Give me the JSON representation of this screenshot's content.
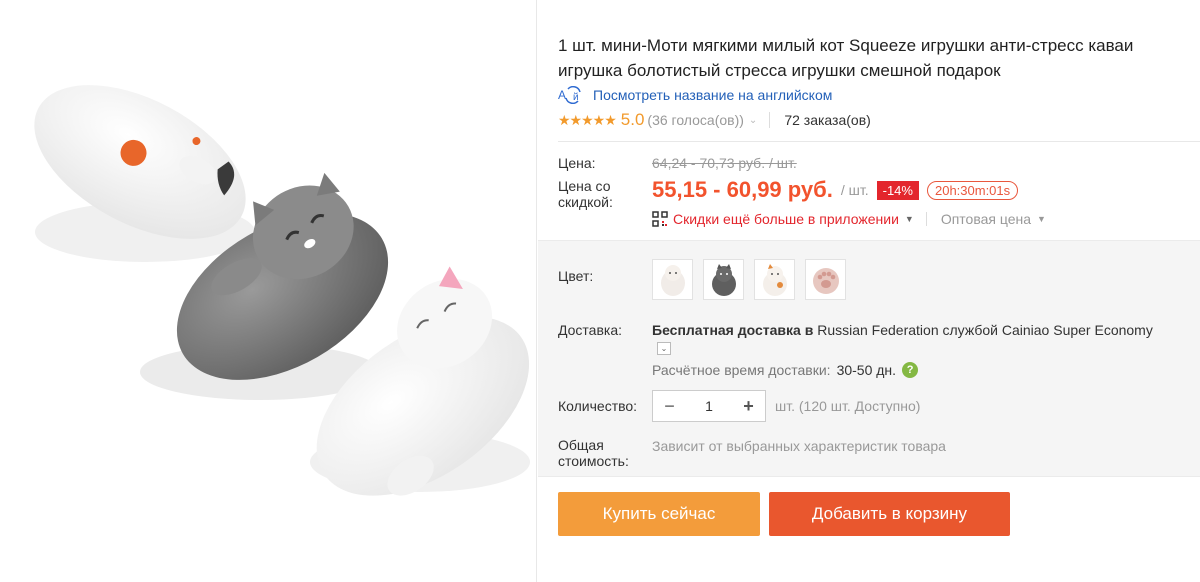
{
  "product": {
    "title": "1 шт. мини-Моти мягкими милый кот Squeeze игрушки анти-стресс каваи игрушка болотистый стресса игрушки смешной подарок",
    "translate_link": "Посмотреть название на английском",
    "translate_icon": "translate-icon",
    "rating": {
      "stars": "★★★★★",
      "value": "5.0",
      "votes": "(36 голоса(ов))",
      "orders": "72 заказа(ов)"
    }
  },
  "price": {
    "price_label": "Цена:",
    "old_price": "64,24 - 70,73 руб. / шт.",
    "discount_label": "Цена со скидкой:",
    "new_price": "55,15 - 60,99 руб.",
    "unit": "/ шт.",
    "discount_badge": "-14%",
    "timer": "20h:30m:01s",
    "app_discount": "Скидки ещё больше в приложении",
    "wholesale": "Оптовая цена",
    "accent_color": "#f2532d"
  },
  "options": {
    "color_label": "Цвет:",
    "swatches": [
      "white cat",
      "grey cat",
      "calico cat",
      "paw"
    ],
    "shipping_label": "Доставка:",
    "shipping_text_bold": "Бесплатная доставка в",
    "shipping_text_rest": " Russian Federation службой Cainiao Super Economy",
    "eta_label": "Расчётное время доставки:",
    "eta_value": "30-50 дн.",
    "quantity_label": "Количество:",
    "quantity_value": "1",
    "quantity_minus": "−",
    "quantity_plus": "+",
    "quantity_available": "шт. (120 шт. Доступно)",
    "total_label": "Общая стоимость:",
    "total_hint": "Зависит от выбранных характеристик товара"
  },
  "actions": {
    "buy_now": "Купить сейчас",
    "add_to_cart": "Добавить в корзину",
    "buy_color": "#f39c3b",
    "cart_color": "#e9572e"
  }
}
